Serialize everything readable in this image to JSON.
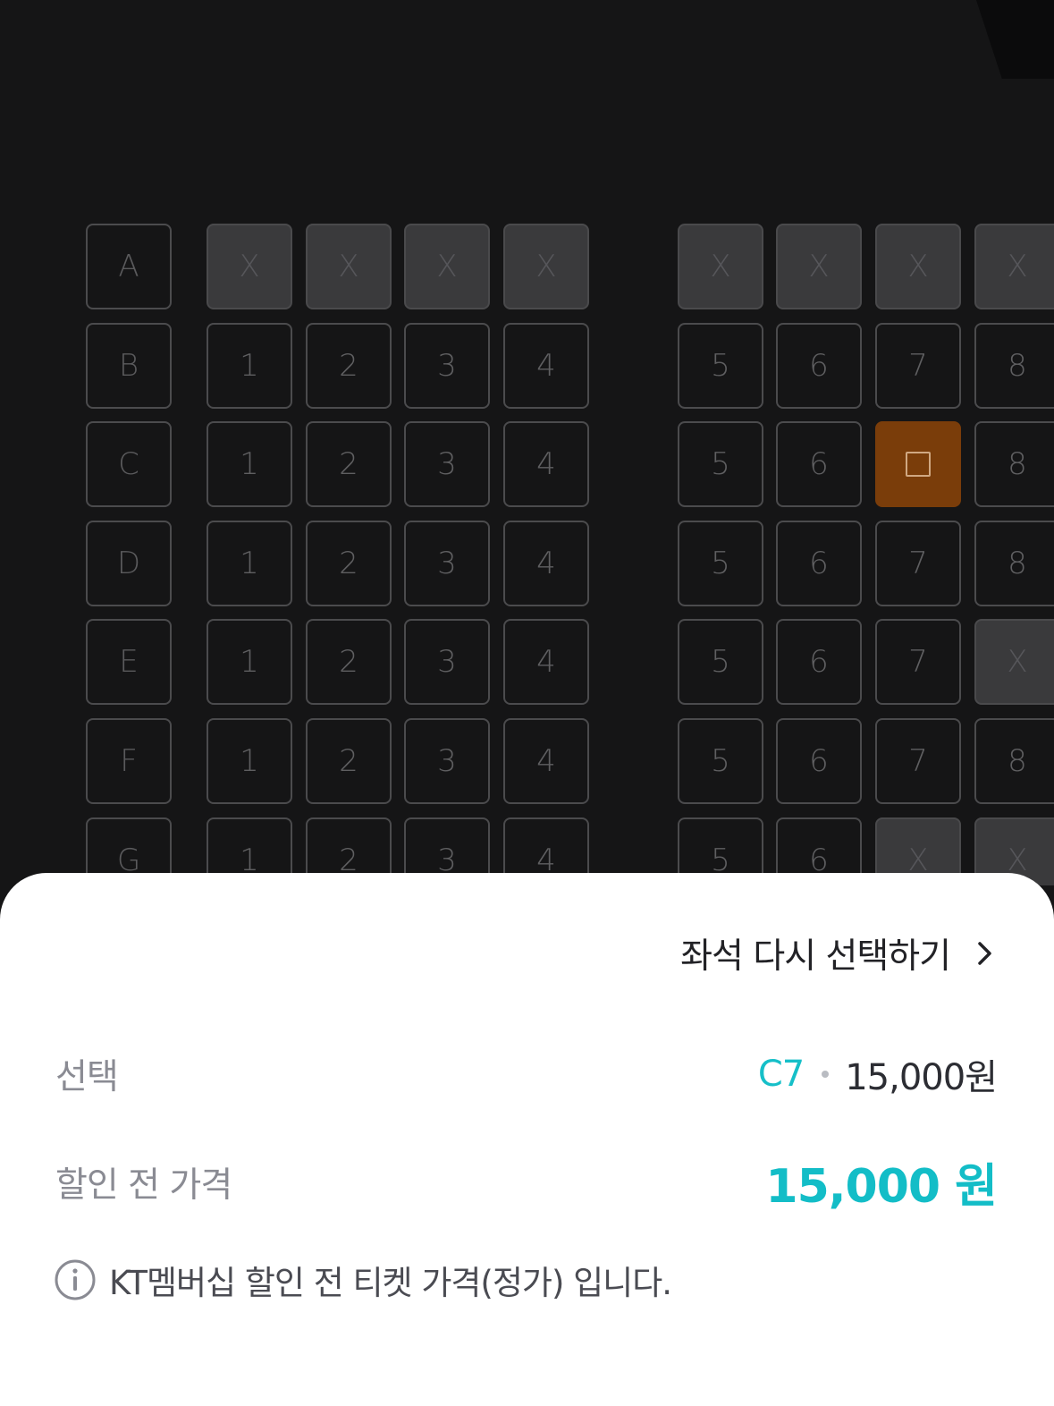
{
  "seatmap": {
    "rows": [
      {
        "label": "A",
        "seats": [
          {
            "text": "X",
            "status": "unavailable"
          },
          {
            "text": "X",
            "status": "unavailable"
          },
          {
            "text": "X",
            "status": "unavailable"
          },
          {
            "text": "X",
            "status": "unavailable"
          },
          {
            "text": "X",
            "status": "unavailable"
          },
          {
            "text": "X",
            "status": "unavailable"
          },
          {
            "text": "X",
            "status": "unavailable"
          },
          {
            "text": "X",
            "status": "unavailable"
          }
        ]
      },
      {
        "label": "B",
        "seats": [
          {
            "text": "1",
            "status": "available"
          },
          {
            "text": "2",
            "status": "available"
          },
          {
            "text": "3",
            "status": "available"
          },
          {
            "text": "4",
            "status": "available"
          },
          {
            "text": "5",
            "status": "available"
          },
          {
            "text": "6",
            "status": "available"
          },
          {
            "text": "7",
            "status": "available"
          },
          {
            "text": "8",
            "status": "available"
          }
        ]
      },
      {
        "label": "C",
        "seats": [
          {
            "text": "1",
            "status": "available"
          },
          {
            "text": "2",
            "status": "available"
          },
          {
            "text": "3",
            "status": "available"
          },
          {
            "text": "4",
            "status": "available"
          },
          {
            "text": "5",
            "status": "available"
          },
          {
            "text": "6",
            "status": "available"
          },
          {
            "text": "",
            "status": "selected"
          },
          {
            "text": "8",
            "status": "available"
          }
        ]
      },
      {
        "label": "D",
        "seats": [
          {
            "text": "1",
            "status": "available"
          },
          {
            "text": "2",
            "status": "available"
          },
          {
            "text": "3",
            "status": "available"
          },
          {
            "text": "4",
            "status": "available"
          },
          {
            "text": "5",
            "status": "available"
          },
          {
            "text": "6",
            "status": "available"
          },
          {
            "text": "7",
            "status": "available"
          },
          {
            "text": "8",
            "status": "available"
          }
        ]
      },
      {
        "label": "E",
        "seats": [
          {
            "text": "1",
            "status": "available"
          },
          {
            "text": "2",
            "status": "available"
          },
          {
            "text": "3",
            "status": "available"
          },
          {
            "text": "4",
            "status": "available"
          },
          {
            "text": "5",
            "status": "available"
          },
          {
            "text": "6",
            "status": "available"
          },
          {
            "text": "7",
            "status": "available"
          },
          {
            "text": "X",
            "status": "unavailable"
          }
        ]
      },
      {
        "label": "F",
        "seats": [
          {
            "text": "1",
            "status": "available"
          },
          {
            "text": "2",
            "status": "available"
          },
          {
            "text": "3",
            "status": "available"
          },
          {
            "text": "4",
            "status": "available"
          },
          {
            "text": "5",
            "status": "available"
          },
          {
            "text": "6",
            "status": "available"
          },
          {
            "text": "7",
            "status": "available"
          },
          {
            "text": "8",
            "status": "available"
          }
        ]
      },
      {
        "label": "G",
        "seats": [
          {
            "text": "1",
            "status": "available"
          },
          {
            "text": "2",
            "status": "available"
          },
          {
            "text": "3",
            "status": "available"
          },
          {
            "text": "4",
            "status": "available"
          },
          {
            "text": "5",
            "status": "available"
          },
          {
            "text": "6",
            "status": "available"
          },
          {
            "text": "X",
            "status": "unavailable"
          },
          {
            "text": "X",
            "status": "unavailable"
          }
        ]
      }
    ]
  },
  "sheet": {
    "reselect_label": "좌석 다시 선택하기",
    "selection_label": "선택",
    "selected_seat": "C7",
    "selected_price": "15,000원",
    "pre_discount_label": "할인 전 가격",
    "pre_discount_total": "15,000 원",
    "notice": "KT멤버십 할인 전 티켓 가격(정가) 입니다."
  },
  "icons": {
    "reselect": "chevron-right-icon",
    "notice": "info-circle-icon",
    "selected_seat": "square-icon"
  },
  "colors": {
    "accent": "#13bdc7",
    "selected_seat": "#7a3d0a",
    "unavailable_seat": "#3a3a3c",
    "background": "#151516"
  }
}
